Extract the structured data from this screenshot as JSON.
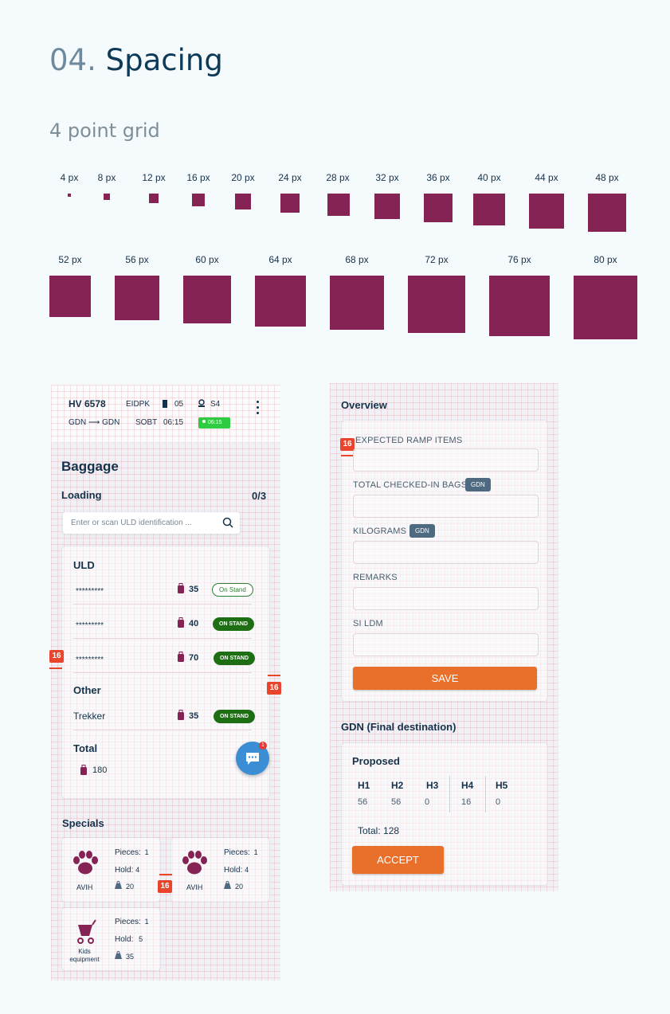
{
  "header": {
    "number": "04.",
    "title": "Spacing",
    "subtitle": "4 point grid"
  },
  "swatches_row1": [
    "4 px",
    "8 px",
    "12 px",
    "16 px",
    "20 px",
    "24 px",
    "28 px",
    "32 px",
    "36 px",
    "40 px",
    "44 px",
    "48 px"
  ],
  "swatches_row2": [
    "52 px",
    "56 px",
    "60 px",
    "64 px",
    "68 px",
    "72 px",
    "76 px",
    "80 px"
  ],
  "colors": {
    "swatch": "#862355",
    "accent": "#e8702a",
    "marker": "#e8452c",
    "status_green": "#1e6e14"
  },
  "spacing_marker": "16",
  "left_screen": {
    "flight": "HV 6578",
    "airport_code": "EIDPK",
    "gate": "05",
    "stand": "S4",
    "route_from": "GDN",
    "route_arrow": "⟶",
    "route_to": "GDN",
    "sobt_label": "SOBT",
    "sobt_time": "06:15",
    "status_time": "06:15",
    "section_title": "Baggage",
    "loading_label": "Loading",
    "loading_count": "0/3",
    "search_placeholder": "Enter or scan ULD identification ...",
    "uld_title": "ULD",
    "uld_rows": [
      {
        "id": "*********",
        "count": "35",
        "status": "On Stand"
      },
      {
        "id": "*********",
        "count": "40",
        "status": "ON STAND"
      },
      {
        "id": "*********",
        "count": "70",
        "status": "ON STAND"
      }
    ],
    "other_title": "Other",
    "other_rows": [
      {
        "id": "Trekker",
        "count": "35",
        "status": "ON STAND"
      }
    ],
    "total_title": "Total",
    "total_value": "180",
    "chat_badge": "1",
    "specials_title": "Specials",
    "specials": [
      {
        "name": "AVIH",
        "pieces_label": "Pieces:",
        "pieces": "1",
        "hold_label": "Hold:",
        "hold": "4",
        "weight": "20"
      },
      {
        "name": "AVIH",
        "pieces_label": "Pieces:",
        "pieces": "1",
        "hold_label": "Hold:",
        "hold": "4",
        "weight": "20"
      },
      {
        "name_line1": "Kids",
        "name_line2": "equipment",
        "pieces_label": "Pieces:",
        "pieces": "1",
        "hold_label": "Hold:",
        "hold": "5",
        "weight": "35"
      }
    ]
  },
  "right_screen": {
    "overview_title": "Overview",
    "fields": [
      {
        "label": "EXPECTED RAMP ITEMS"
      },
      {
        "label": "TOTAL CHECKED-IN BAGS",
        "tag": "GDN"
      },
      {
        "label": "KILOGRAMS",
        "tag": "GDN"
      },
      {
        "label": "REMARKS"
      },
      {
        "label": "SI LDM"
      }
    ],
    "save_label": "SAVE",
    "dest_title": "GDN (Final destination)",
    "proposed_title": "Proposed",
    "holds": [
      {
        "h": "H1",
        "v": "56"
      },
      {
        "h": "H2",
        "v": "56"
      },
      {
        "h": "H3",
        "v": "0"
      },
      {
        "h": "H4",
        "v": "16"
      },
      {
        "h": "H5",
        "v": "0"
      }
    ],
    "total_label": "Total: 128",
    "accept_label": "ACCEPT"
  }
}
